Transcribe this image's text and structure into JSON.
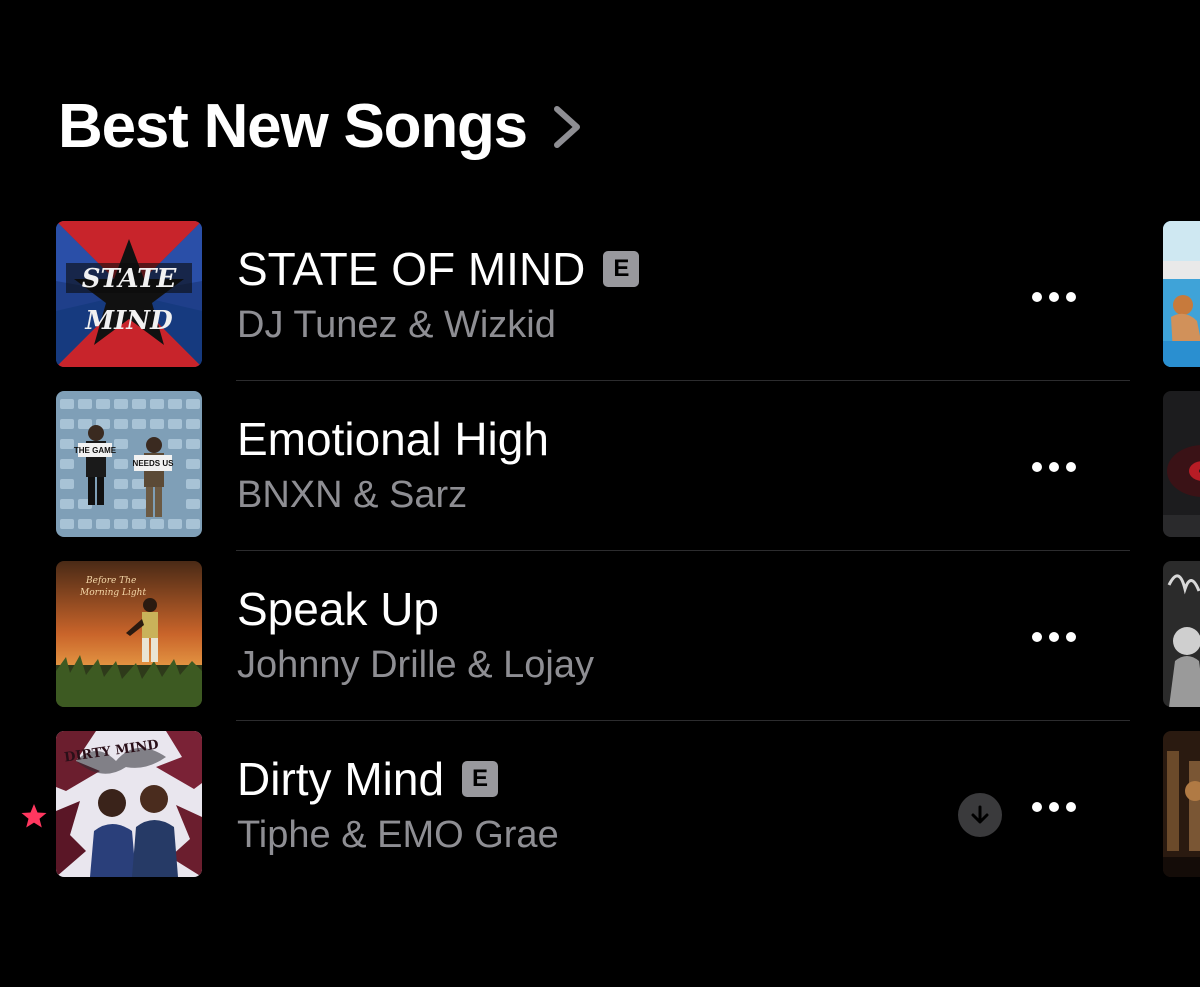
{
  "section": {
    "title": "Best New Songs"
  },
  "songs": [
    {
      "title": "STATE OF MIND",
      "artist": "DJ Tunez & Wizkid",
      "explicit": true,
      "explicit_label": "E",
      "downloaded": false,
      "favorite": false,
      "artwork_text": "STATE MIND"
    },
    {
      "title": "Emotional High",
      "artist": "BNXN & Sarz",
      "explicit": false,
      "downloaded": false,
      "favorite": false,
      "artwork_text": "THE GAME NEEDS US"
    },
    {
      "title": "Speak Up",
      "artist": "Johnny Drille & Lojay",
      "explicit": false,
      "downloaded": false,
      "favorite": false,
      "artwork_text": "Before The Morning Light"
    },
    {
      "title": "Dirty Mind",
      "artist": "Tiphe & EMO Grae",
      "explicit": true,
      "explicit_label": "E",
      "downloaded": true,
      "favorite": true,
      "artwork_text": "DIRTY MIND"
    }
  ],
  "icons": {
    "section_chevron": "chevron-right-icon",
    "more": "ellipsis-icon",
    "download": "download-arrow-icon",
    "favorite": "star-icon"
  },
  "colors": {
    "background": "#000000",
    "primary_text": "#ffffff",
    "secondary_text": "#8e8e93",
    "explicit_badge": "#98989d",
    "favorite_star": "#ff375f",
    "download_circle": "#3a3a3c"
  }
}
